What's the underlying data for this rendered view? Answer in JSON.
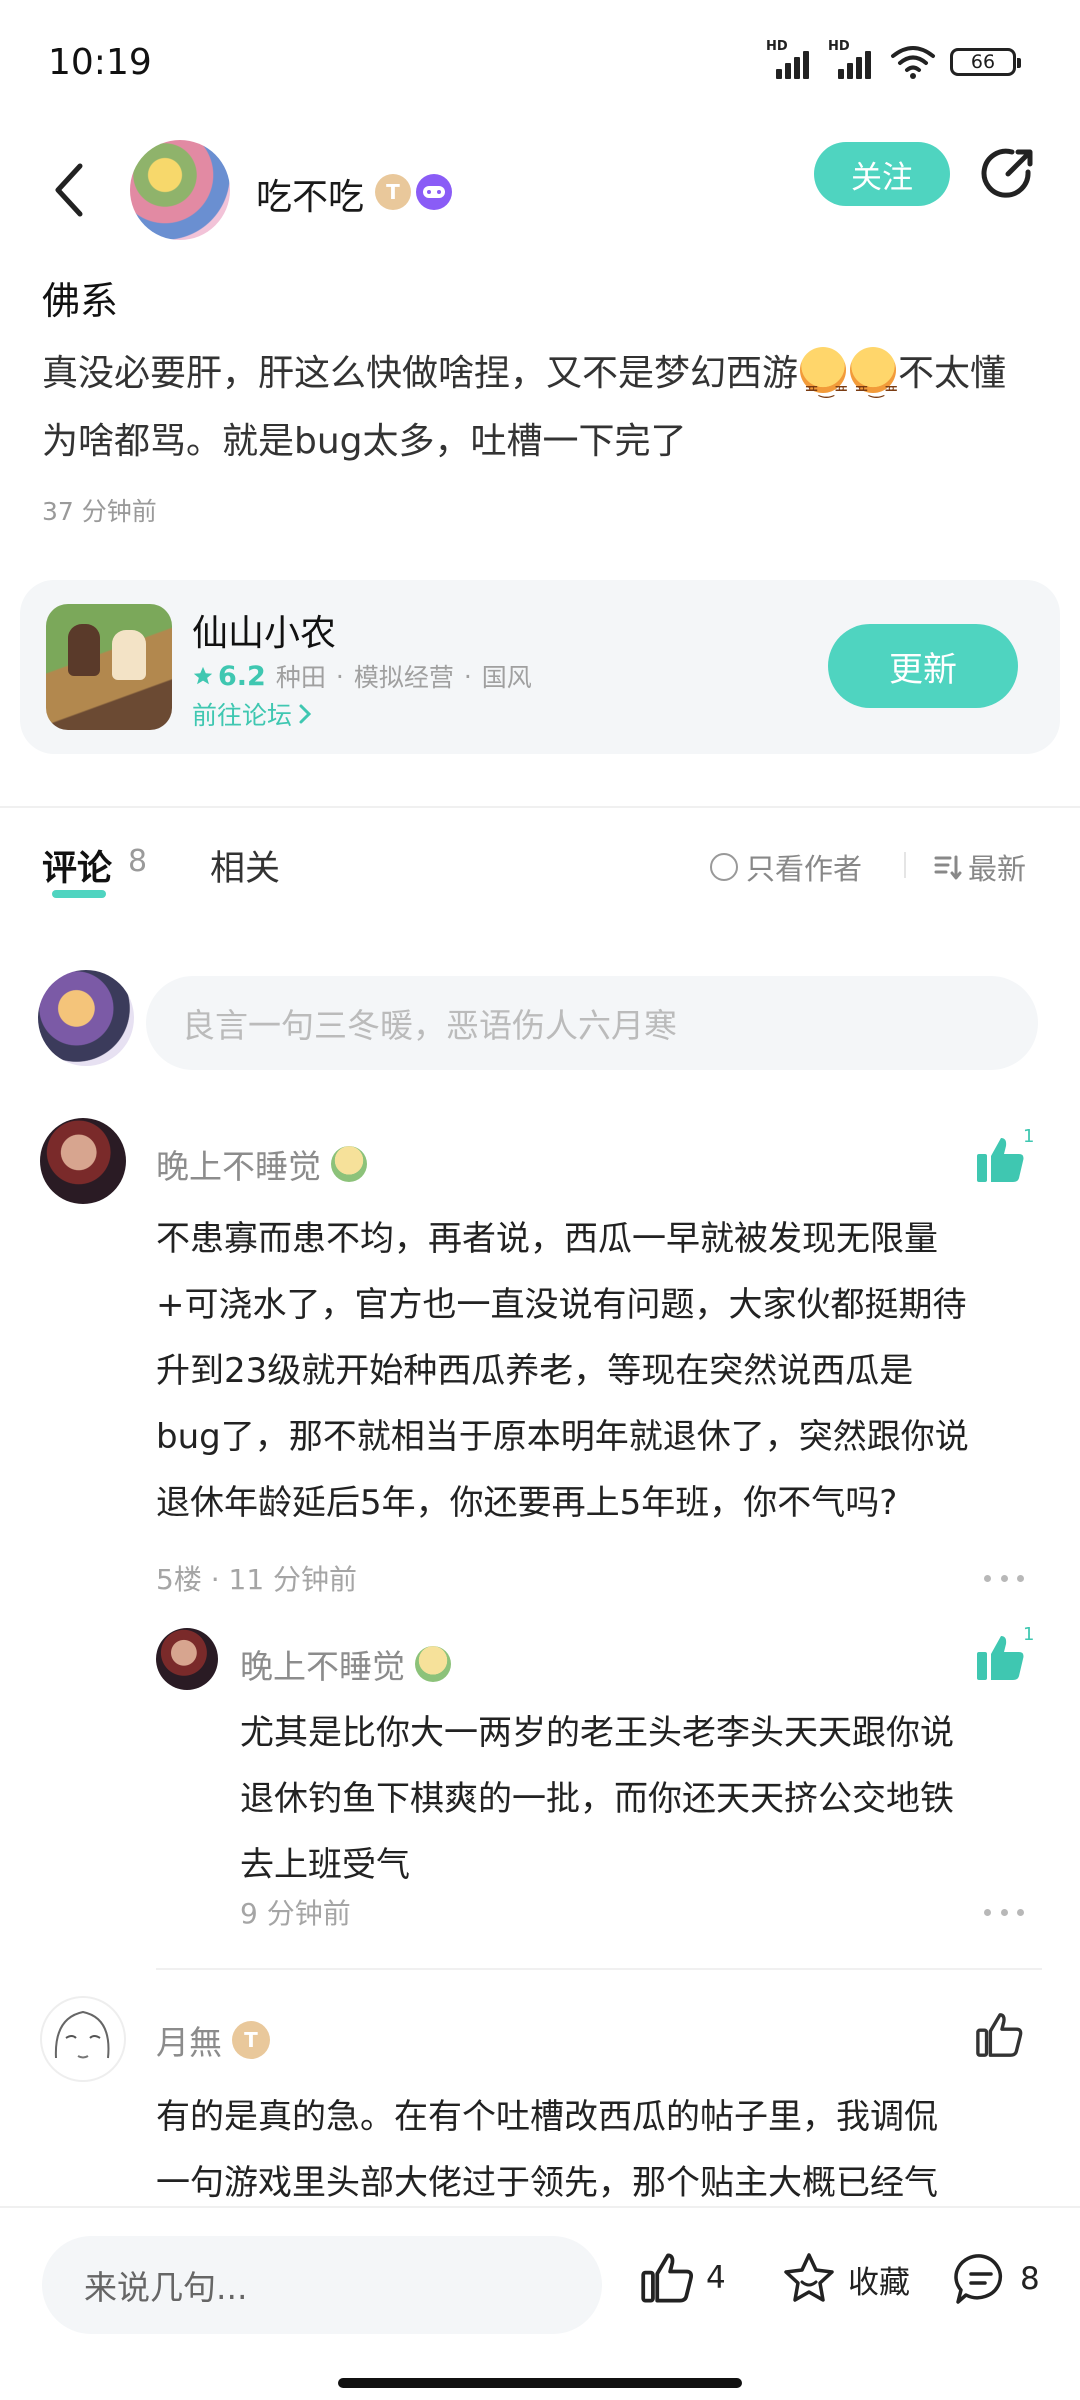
{
  "status": {
    "time": "10:19",
    "hd1": "HD",
    "hd2": "HD",
    "battery": "66"
  },
  "header": {
    "author": "吃不吃",
    "badge_t": "T",
    "follow_label": "关注"
  },
  "post": {
    "title": "佛系",
    "body_before_emoji": "真没必要肝，肝这么快做啥捏，又不是梦幻西游",
    "body_after_emoji": "不太懂为啥都骂。就是bug太多，吐槽一下完了",
    "time": "37 分钟前"
  },
  "game": {
    "name": "仙山小农",
    "rating": "6.2",
    "tags": [
      "种田",
      "模拟经营",
      "国风"
    ],
    "separator": "·",
    "forum_link": "前往论坛",
    "update_label": "更新"
  },
  "tabs": {
    "comments_label": "评论",
    "comments_count": "8",
    "related_label": "相关",
    "only_author_label": "只看作者",
    "sort_label": "最新"
  },
  "comment_input": {
    "placeholder": "良言一句三冬暖，恶语伤人六月寒"
  },
  "comments": [
    {
      "user": "晚上不睡觉",
      "likes": "1",
      "lines": [
        "不患寡而患不均，再者说，西瓜一早就被发现无限量",
        "+可浇水了，官方也一直没说有问题，大家伙都挺期待",
        "升到23级就开始种西瓜养老，等现在突然说西瓜是",
        "bug了，那不就相当于原本明年就退休了，突然跟你说",
        "退休年龄延后5年，你还要再上5年班，你不气吗?"
      ],
      "meta": "5楼 · 11 分钟前",
      "reply": {
        "user": "晚上不睡觉",
        "likes": "1",
        "lines": [
          "尤其是比你大一两岁的老王头老李头天天跟你说",
          "退休钓鱼下棋爽的一批，而你还天天挤公交地铁",
          "去上班受气"
        ],
        "meta": "9 分钟前"
      }
    },
    {
      "user": "月無",
      "badge": "T",
      "lines": [
        "有的是真的急。在有个吐槽改西瓜的帖子里，我调侃",
        "一句游戏里头部大佬过于领先，那个贴主大概已经气"
      ]
    }
  ],
  "bottom": {
    "say_placeholder": "来说几句...",
    "like_count": "4",
    "favorite_label": "收藏",
    "comment_count": "8"
  },
  "colors": {
    "accent": "#4fd4c0",
    "accent_text": "#3fc7b1"
  }
}
